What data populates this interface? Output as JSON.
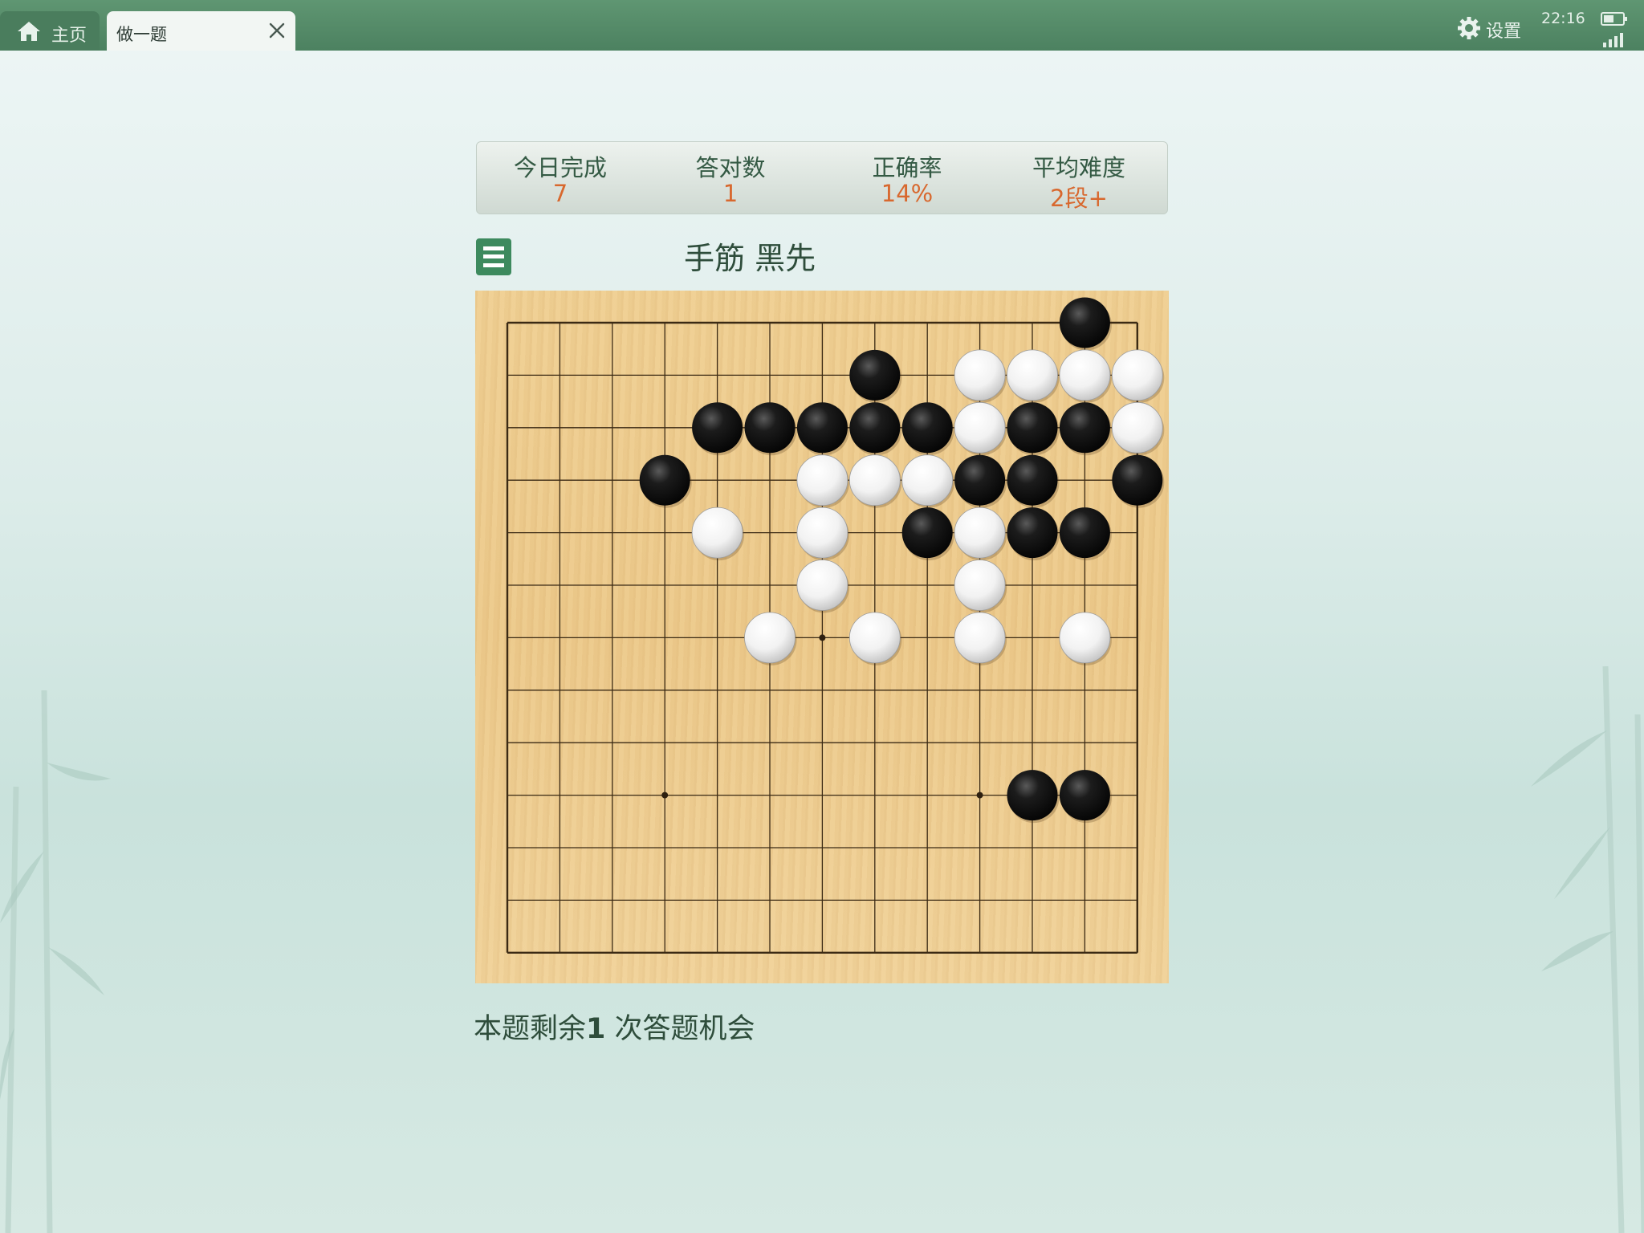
{
  "tabs": {
    "home": {
      "label": "主页",
      "icon": "home-icon"
    },
    "active": {
      "label": "做一题",
      "close_icon": "close-icon"
    }
  },
  "header": {
    "settings_label": "设置",
    "settings_icon": "gear-icon",
    "time": "22:16"
  },
  "stats": [
    {
      "label": "今日完成",
      "value": "7"
    },
    {
      "label": "答对数",
      "value": "1"
    },
    {
      "label": "正确率",
      "value": "14%"
    },
    {
      "label": "平均难度",
      "value": "2段+"
    }
  ],
  "problem": {
    "menu_icon": "menu-icon",
    "title": "手筋  黑先",
    "remaining_prefix": "本题剩余",
    "remaining_count": "1",
    "remaining_suffix": " 次答题机会"
  },
  "board": {
    "size_cols": 13,
    "size_rows": 13,
    "star_points": [
      [
        6,
        6
      ],
      [
        3,
        9
      ],
      [
        9,
        9
      ]
    ],
    "stones": [
      {
        "c": "b",
        "x": 11,
        "y": 0
      },
      {
        "c": "b",
        "x": 7,
        "y": 1
      },
      {
        "c": "w",
        "x": 9,
        "y": 1
      },
      {
        "c": "w",
        "x": 10,
        "y": 1
      },
      {
        "c": "w",
        "x": 11,
        "y": 1
      },
      {
        "c": "w",
        "x": 12,
        "y": 1
      },
      {
        "c": "b",
        "x": 4,
        "y": 2
      },
      {
        "c": "b",
        "x": 5,
        "y": 2
      },
      {
        "c": "b",
        "x": 6,
        "y": 2
      },
      {
        "c": "b",
        "x": 7,
        "y": 2
      },
      {
        "c": "b",
        "x": 8,
        "y": 2
      },
      {
        "c": "w",
        "x": 9,
        "y": 2
      },
      {
        "c": "b",
        "x": 10,
        "y": 2
      },
      {
        "c": "b",
        "x": 11,
        "y": 2
      },
      {
        "c": "w",
        "x": 12,
        "y": 2
      },
      {
        "c": "b",
        "x": 3,
        "y": 3
      },
      {
        "c": "w",
        "x": 6,
        "y": 3
      },
      {
        "c": "w",
        "x": 7,
        "y": 3
      },
      {
        "c": "w",
        "x": 8,
        "y": 3
      },
      {
        "c": "b",
        "x": 9,
        "y": 3
      },
      {
        "c": "b",
        "x": 10,
        "y": 3
      },
      {
        "c": "b",
        "x": 12,
        "y": 3
      },
      {
        "c": "w",
        "x": 4,
        "y": 4
      },
      {
        "c": "w",
        "x": 6,
        "y": 4
      },
      {
        "c": "b",
        "x": 8,
        "y": 4
      },
      {
        "c": "w",
        "x": 9,
        "y": 4
      },
      {
        "c": "b",
        "x": 10,
        "y": 4
      },
      {
        "c": "b",
        "x": 11,
        "y": 4
      },
      {
        "c": "w",
        "x": 6,
        "y": 5
      },
      {
        "c": "w",
        "x": 9,
        "y": 5
      },
      {
        "c": "w",
        "x": 5,
        "y": 6
      },
      {
        "c": "w",
        "x": 7,
        "y": 6
      },
      {
        "c": "w",
        "x": 9,
        "y": 6
      },
      {
        "c": "w",
        "x": 11,
        "y": 6
      },
      {
        "c": "b",
        "x": 10,
        "y": 9
      },
      {
        "c": "b",
        "x": 11,
        "y": 9
      }
    ]
  }
}
